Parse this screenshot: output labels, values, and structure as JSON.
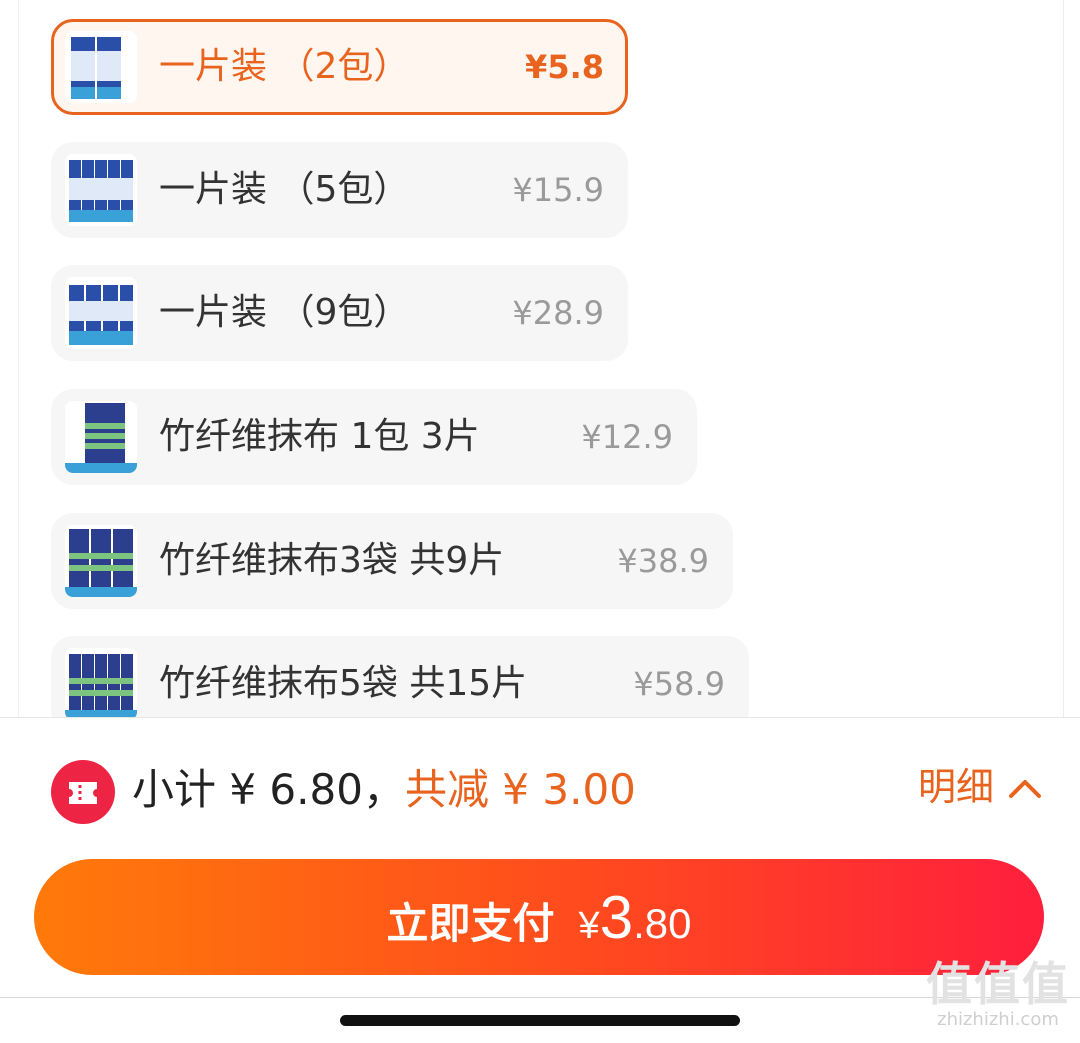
{
  "skus": [
    {
      "name": "一片装 （2包）",
      "price": "¥5.8",
      "selected": true,
      "icon": "cleaning-pack-thumbnail"
    },
    {
      "name": "一片装 （5包）",
      "price": "¥15.9",
      "selected": false,
      "icon": "cleaning-pack-thumbnail"
    },
    {
      "name": "一片装 （9包）",
      "price": "¥28.9",
      "selected": false,
      "icon": "cleaning-pack-thumbnail"
    },
    {
      "name": "竹纤维抹布 1包 3片",
      "price": "¥12.9",
      "selected": false,
      "icon": "bamboo-cloth-thumbnail"
    },
    {
      "name": "竹纤维抹布3袋 共9片",
      "price": "¥38.9",
      "selected": false,
      "icon": "bamboo-cloth-thumbnail"
    },
    {
      "name": "竹纤维抹布5袋 共15片",
      "price": "¥58.9",
      "selected": false,
      "icon": "bamboo-cloth-thumbnail"
    }
  ],
  "footer": {
    "subtotal_label": "小计 ¥ 6.80，",
    "reduce_label": "共减 ¥ 3.00",
    "detail_label": "明细",
    "detail_icon": "chevron-up-icon",
    "coupon_icon": "coupon-icon",
    "pay_label": "立即支付",
    "pay_currency": "¥",
    "pay_amount_int": "3",
    "pay_amount_dec": ".80"
  },
  "watermark": {
    "logo": "值值值",
    "url": "zhizhizhi.com"
  },
  "colors": {
    "accent": "#e8641e",
    "pay_start": "#ff7a0a",
    "pay_end": "#ff1f3d",
    "coupon": "#ee2444"
  }
}
